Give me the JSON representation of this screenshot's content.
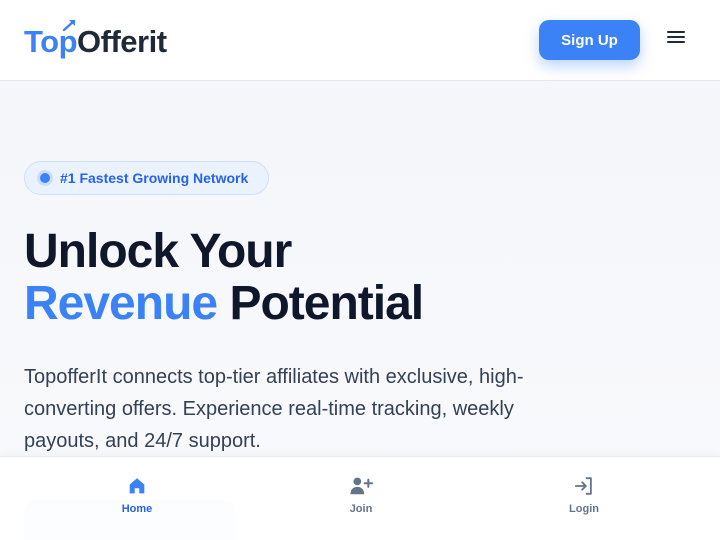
{
  "header": {
    "logo_top": "Top",
    "logo_offer": "Offerit",
    "signup_label": "Sign Up",
    "menu_icon": "hamburger-menu-icon"
  },
  "hero": {
    "badge": "#1 Fastest Growing Network",
    "headline_line1": "Unlock Your",
    "headline_accent": "Revenue",
    "headline_rest": "Potential",
    "description": "TopofferIt connects top-tier affiliates with exclusive, high-converting offers. Experience real-time tracking, weekly payouts, and 24/7 support."
  },
  "bottom_nav": {
    "items": [
      {
        "label": "Home",
        "icon": "home-icon",
        "active": true
      },
      {
        "label": "Join",
        "icon": "user-plus-icon",
        "active": false
      },
      {
        "label": "Login",
        "icon": "login-icon",
        "active": false
      }
    ]
  },
  "colors": {
    "accent": "#3b82f6",
    "text_dark": "#0f172a",
    "muted": "#64748b"
  }
}
